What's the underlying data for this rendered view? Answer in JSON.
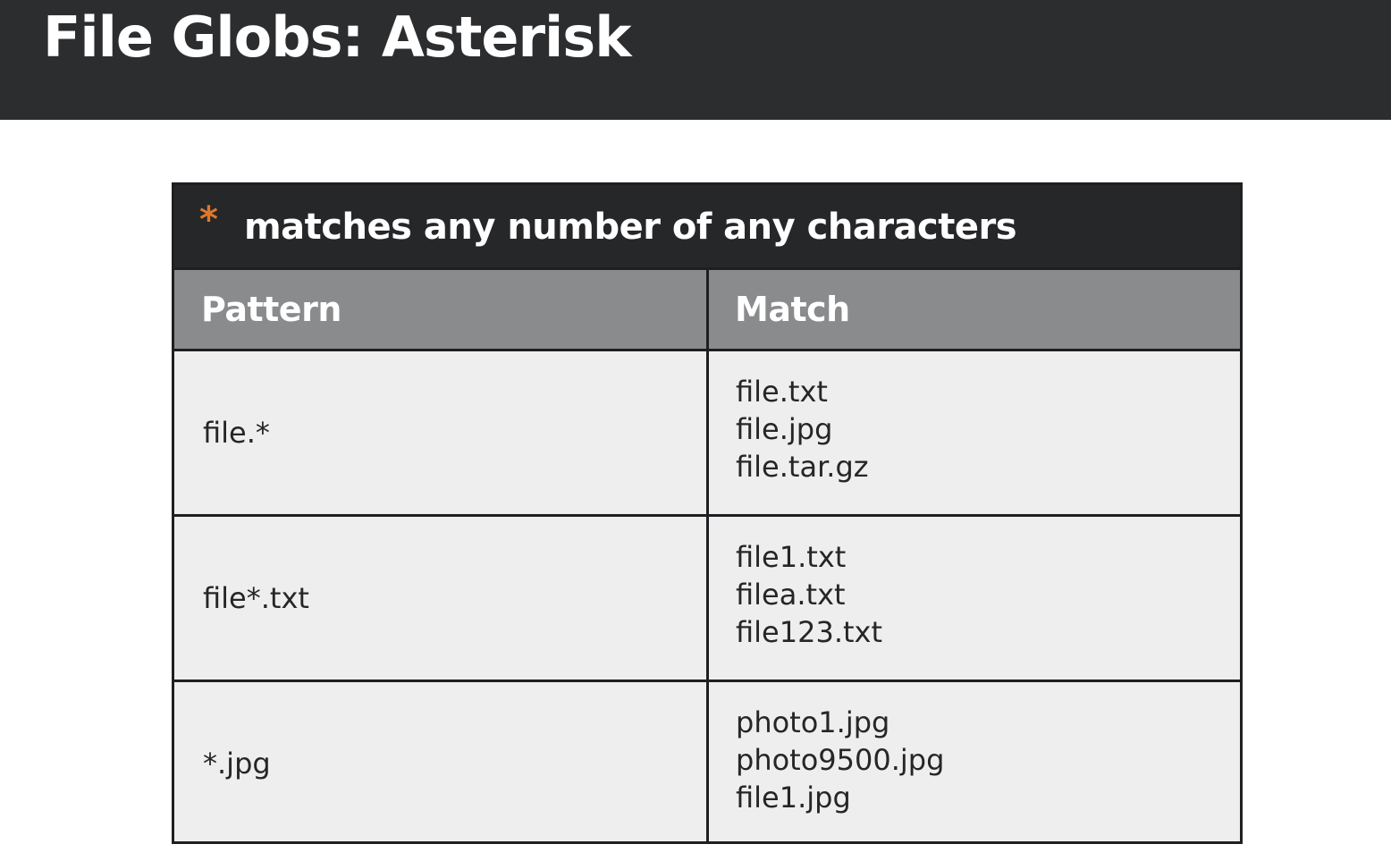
{
  "slide": {
    "title": "File Globs: Asterisk"
  },
  "colors": {
    "title_bar": "#2c2d2f",
    "table_caption": "#262729",
    "table_header": "#8a8b8d",
    "table_body": "#eeeeee",
    "accent_asterisk": "#e0782a",
    "border": "#1f1f21"
  },
  "table": {
    "caption_symbol": "*",
    "caption": "matches any number of any characters",
    "headers": {
      "pattern": "Pattern",
      "match": "Match"
    },
    "rows": [
      {
        "pattern": "file.*",
        "matches": [
          "file.txt",
          "file.jpg",
          "file.tar.gz"
        ]
      },
      {
        "pattern": "file*.txt",
        "matches": [
          "file1.txt",
          "filea.txt",
          "file123.txt"
        ]
      },
      {
        "pattern": "*.jpg",
        "matches": [
          "photo1.jpg",
          "photo9500.jpg",
          "file1.jpg"
        ]
      }
    ]
  }
}
